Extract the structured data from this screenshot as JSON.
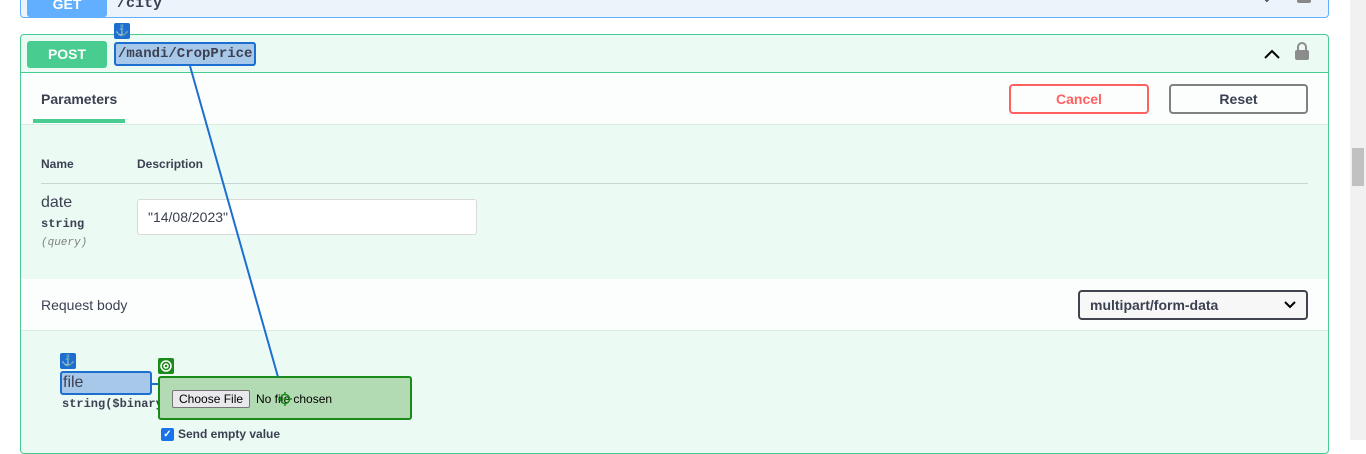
{
  "get_op": {
    "method": "GET",
    "path": "/city"
  },
  "post_op": {
    "method": "POST",
    "path": "/mandi/CropPrice"
  },
  "tabs": {
    "parameters": "Parameters"
  },
  "buttons": {
    "cancel": "Cancel",
    "reset": "Reset"
  },
  "params_table": {
    "col_name": "Name",
    "col_description": "Description",
    "rows": [
      {
        "name": "date",
        "type": "string",
        "in": "(query)",
        "value": "\"14/08/2023\""
      }
    ]
  },
  "request_body": {
    "label": "Request body",
    "content_type": "multipart/form-data",
    "field": {
      "name": "file",
      "type": "string($binary)"
    },
    "file_input": {
      "button": "Choose File",
      "status": "No file chosen"
    },
    "send_empty_label": "Send empty value",
    "send_empty_checked": true
  },
  "colors": {
    "post": "#49cc90",
    "get": "#61affe",
    "cancel": "#ff6060",
    "highlight": "#1c6fd1",
    "target": "#1a8a1a"
  },
  "icons": {
    "anchor": "anchor-icon",
    "target": "target-icon",
    "lock": "lock-icon",
    "chevron_up": "chevron-up-icon",
    "chevron_down": "chevron-down-icon"
  }
}
